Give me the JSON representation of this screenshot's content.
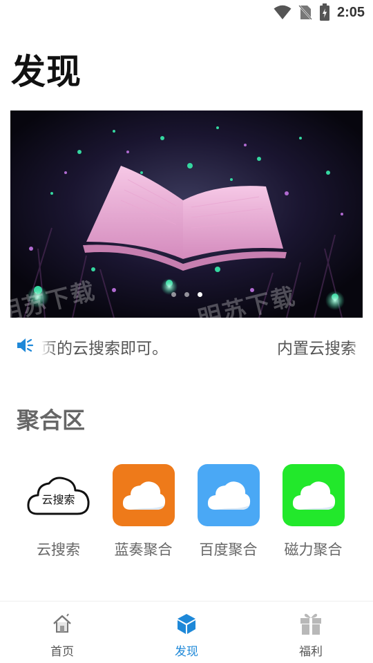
{
  "status_bar": {
    "time": "2:05"
  },
  "page": {
    "title": "发现"
  },
  "banner": {
    "watermark": "明苏下载",
    "dots": 3,
    "active_dot": 2
  },
  "notice": {
    "text_a": "页的云搜索即可。",
    "text_b": "内置云搜索"
  },
  "section": {
    "title": "聚合区",
    "tiles": [
      {
        "label": "云搜索",
        "icon": "cloud-search-icon",
        "badge_text": "云搜索",
        "color": "#ffffff"
      },
      {
        "label": "蓝奏聚合",
        "icon": "cloud-icon",
        "color": "#ee7a1a"
      },
      {
        "label": "百度聚合",
        "icon": "cloud-icon",
        "color": "#4aa8f5"
      },
      {
        "label": "磁力聚合",
        "icon": "cloud-icon",
        "color": "#22e82b"
      }
    ]
  },
  "nav": {
    "items": [
      {
        "label": "首页",
        "icon": "home-icon",
        "active": false
      },
      {
        "label": "发现",
        "icon": "cube-icon",
        "active": true
      },
      {
        "label": "福利",
        "icon": "gift-icon",
        "active": false
      }
    ],
    "active_color": "#1e88d8"
  }
}
